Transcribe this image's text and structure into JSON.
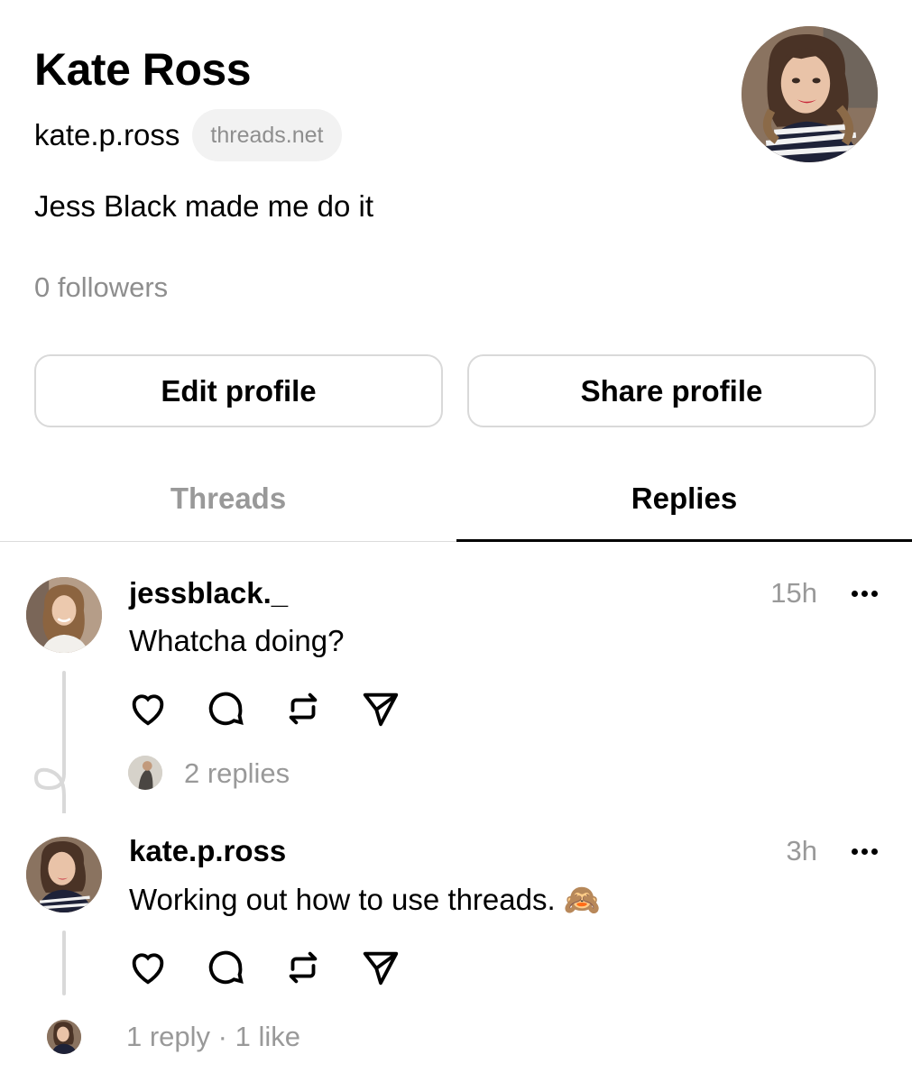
{
  "profile": {
    "name": "Kate Ross",
    "handle": "kate.p.ross",
    "domain_badge": "threads.net",
    "bio": "Jess Black made me do it",
    "followers": "0 followers"
  },
  "buttons": {
    "edit": "Edit profile",
    "share": "Share profile"
  },
  "tabs": [
    {
      "label": "Threads",
      "active": false
    },
    {
      "label": "Replies",
      "active": true
    }
  ],
  "posts": [
    {
      "username": "jessblack._",
      "text": "Whatcha doing?",
      "time": "15h",
      "meta": "2 replies"
    },
    {
      "username": "kate.p.ross",
      "text": "Working out how to use threads. 🙈",
      "time": "3h",
      "meta": "1 reply · 1 like"
    }
  ],
  "icons": {
    "more": "more-icon",
    "like": "heart-icon",
    "comment": "comment-icon",
    "repost": "repost-icon",
    "share": "send-icon"
  },
  "colors": {
    "text": "#000000",
    "secondary": "#999999",
    "border": "#d9d9d9",
    "pill_bg": "#f2f2f2"
  }
}
